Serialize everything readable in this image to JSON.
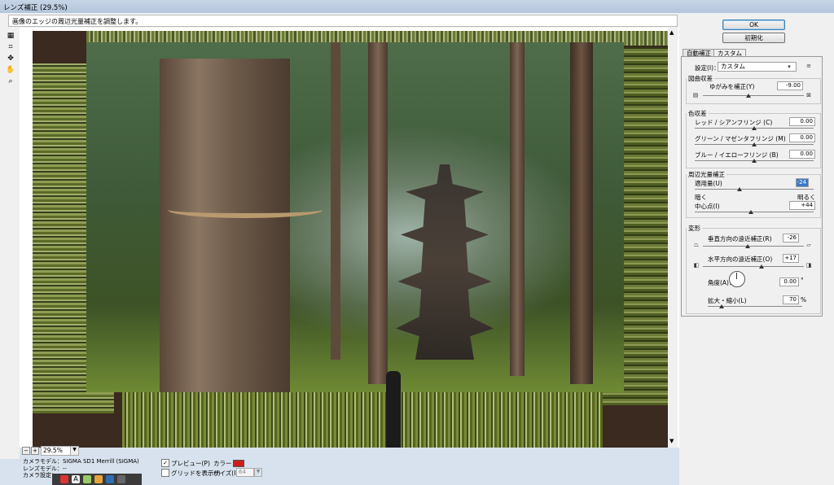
{
  "window": {
    "title": "レンズ補正 (29.5%)"
  },
  "description": "画像のエッジの周辺光量補正を調整します。",
  "tools": [
    {
      "icon": "lens-correction-tool-icon"
    },
    {
      "icon": "grid-tool-icon"
    },
    {
      "icon": "move-grid-tool-icon"
    },
    {
      "icon": "hand-tool-icon"
    },
    {
      "icon": "zoom-tool-icon"
    }
  ],
  "zoom": {
    "value": "29.5%",
    "minus": "−",
    "plus": "+"
  },
  "camera_info": {
    "line1": "カメラモデル：SIGMA SD1 Merrill (SIGMA)",
    "line2": "レンズモデル：--",
    "line3": "カメラ設定：ーー"
  },
  "bottom_options": {
    "preview_label": "プレビュー(P)",
    "preview_checked": true,
    "grid_label": "グリッドを表示(I)",
    "grid_checked": false,
    "color_label": "カラー：",
    "color_value": "#cc1d1d",
    "size_label": "サイズ(I)：",
    "size_value": "64"
  },
  "buttons": {
    "ok": "OK",
    "reset": "初期化"
  },
  "tabs": [
    {
      "label": "自動補正",
      "active": false
    },
    {
      "label": "カスタム",
      "active": true
    }
  ],
  "settings": {
    "label": "設定(I)：",
    "value": "カスタム",
    "menu_icon": "▾≡"
  },
  "distortion": {
    "header": "図曲収差",
    "label": "ゆがみを補正(Y)",
    "value": "-9.00",
    "slider_fraction": 0.45
  },
  "chromatic": {
    "header": "色収差",
    "rows": [
      {
        "label": "レッド / シアンフリンジ (C)",
        "value": "0.00",
        "slider_fraction": 0.5
      },
      {
        "label": "グリーン / マゼンタフリンジ (M)",
        "value": "0.00",
        "slider_fraction": 0.5
      },
      {
        "label": "ブルー / イエローフリンジ (B)",
        "value": "0.00",
        "slider_fraction": 0.5
      }
    ]
  },
  "vignette": {
    "header": "周辺光量補正",
    "amount_label": "適用量(U)",
    "amount_value": "-24",
    "amount_fraction": 0.38,
    "darker": "暗く",
    "lighter": "明るく",
    "midpoint_label": "中心点(I)",
    "midpoint_value": "+44",
    "midpoint_fraction": 0.47
  },
  "transform": {
    "header": "変形",
    "vertical_label": "垂直方向の遠近補正(R)",
    "vertical_value": "-26",
    "vertical_fraction": 0.44,
    "horizontal_label": "水平方向の遠近補正(O)",
    "horizontal_value": "+17",
    "horizontal_fraction": 0.58,
    "angle_label": "角度(A)：",
    "angle_value": "0.00",
    "angle_unit": "°",
    "scale_label": "拡大・縮小(L)",
    "scale_value": "70",
    "scale_unit": "%",
    "scale_fraction": 0.15
  },
  "colors": {
    "accent": "#3c7fb1",
    "titlebar": "#b3c6dc"
  }
}
